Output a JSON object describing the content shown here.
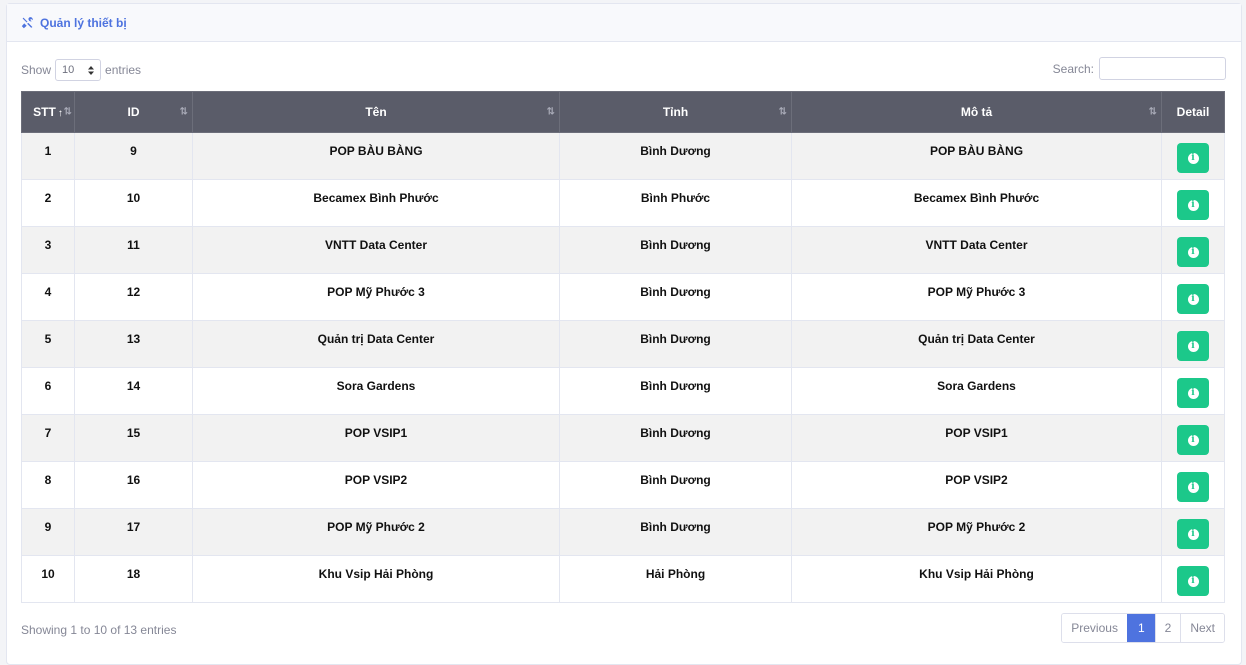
{
  "header": {
    "title": "Quản lý thiết bị",
    "icon": "tools-icon"
  },
  "length_control": {
    "prefix": "Show",
    "value": "10",
    "suffix": "entries"
  },
  "search": {
    "label": "Search:",
    "value": ""
  },
  "table": {
    "columns": [
      "STT",
      "ID",
      "Tên",
      "Tỉnh",
      "Mô tả",
      "Detail"
    ],
    "rows": [
      {
        "stt": "1",
        "id": "9",
        "ten": "POP BÀU BÀNG",
        "tinh": "Bình Dương",
        "mota": "POP BÀU BÀNG"
      },
      {
        "stt": "2",
        "id": "10",
        "ten": "Becamex Bình Phước",
        "tinh": "Bình Phước",
        "mota": "Becamex Bình Phước"
      },
      {
        "stt": "3",
        "id": "11",
        "ten": "VNTT Data Center",
        "tinh": "Bình Dương",
        "mota": "VNTT Data Center"
      },
      {
        "stt": "4",
        "id": "12",
        "ten": "POP Mỹ Phước 3",
        "tinh": "Bình Dương",
        "mota": "POP Mỹ Phước 3"
      },
      {
        "stt": "5",
        "id": "13",
        "ten": "Quản trị Data Center",
        "tinh": "Bình Dương",
        "mota": "Quản trị Data Center"
      },
      {
        "stt": "6",
        "id": "14",
        "ten": "Sora Gardens",
        "tinh": "Bình Dương",
        "mota": "Sora Gardens"
      },
      {
        "stt": "7",
        "id": "15",
        "ten": "POP VSIP1",
        "tinh": "Bình Dương",
        "mota": "POP VSIP1"
      },
      {
        "stt": "8",
        "id": "16",
        "ten": "POP VSIP2",
        "tinh": "Bình Dương",
        "mota": "POP VSIP2"
      },
      {
        "stt": "9",
        "id": "17",
        "ten": "POP Mỹ Phước 2",
        "tinh": "Bình Dương",
        "mota": "POP Mỹ Phước 2"
      },
      {
        "stt": "10",
        "id": "18",
        "ten": "Khu Vsip Hải Phòng",
        "tinh": "Hải Phòng",
        "mota": "Khu Vsip Hải Phòng"
      }
    ]
  },
  "footer": {
    "info": "Showing 1 to 10 of 13 entries"
  },
  "pagination": {
    "previous": "Previous",
    "pages": [
      "1",
      "2"
    ],
    "active": "1",
    "next": "Next"
  },
  "colors": {
    "accent": "#4e73df",
    "header_bg": "#5a5c69",
    "success": "#1cc88a"
  }
}
